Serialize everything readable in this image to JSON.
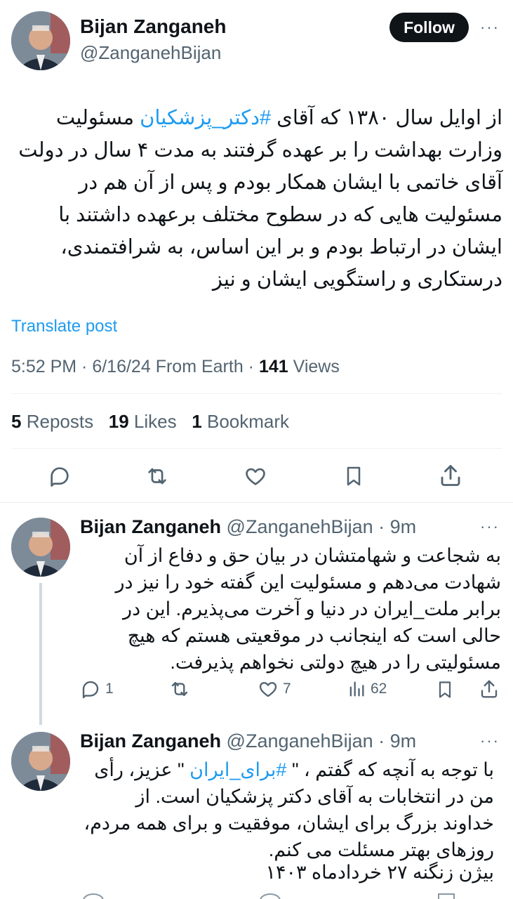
{
  "main_post": {
    "author_name": "Bijan Zanganeh",
    "author_handle": "@ZanganehBijan",
    "follow_label": "Follow",
    "text_before_tag": "از اوایل سال ۱۳۸۰ که آقای ",
    "hashtag": "#دکتر_پزشکیان",
    "text_after_tag": " مسئولیت وزارت بهداشت را بر عهده گرفتند به مدت ۴ سال در دولت آقای خاتمی با ایشان همکار بودم و پس از آن هم در مسئولیت هایی که در سطوح مختلف برعهده داشتند با ایشان در ارتباط بودم و بر این اساس، به شرافتمندی، درستکاری و راستگویی ایشان و نیز",
    "translate_label": "Translate post",
    "time": "5:52 PM",
    "date": "6/16/24",
    "source": "From Earth",
    "views_count": "141",
    "views_label": "Views",
    "reposts_count": "5",
    "reposts_label": "Reposts",
    "likes_count": "19",
    "likes_label": "Likes",
    "bookmarks_count": "1",
    "bookmarks_label": "Bookmark"
  },
  "replies": [
    {
      "author_name": "Bijan Zanganeh",
      "author_handle": "@ZanganehBijan",
      "time_ago": "9m",
      "text": "به شجاعت و شهامتشان در بیان حق و دفاع از آن شهادت می‌دهم و مسئولیت این گفته خود را نیز در برابر ملت_ایران در دنیا و آخرت می‌پذیرم. این در حالی است که اینجانب در موقعیتی هستم که هیچ مسئولیتی را در هیچ دولتی نخواهم پذیرفت.",
      "reply_count": "1",
      "repost_count": "",
      "like_count": "7",
      "views_count": "62"
    },
    {
      "author_name": "Bijan Zanganeh",
      "author_handle": "@ZanganehBijan",
      "time_ago": "9m",
      "text_before_tag": "با توجه به آنچه که گفتم ، \" ",
      "hashtag": "#برای_ایران",
      "text_after_tag": " \" عزیز، رأی من در انتخابات به آقای دکتر پزشکیان است. از خداوند بزرگ برای ایشان، موفقیت و برای همه مردم، روزهای بهتر مسئلت می کنم.",
      "signature": "بیژن زنگنه  ۲۷ خردادماه ۱۴۰۳"
    }
  ],
  "icons": [
    "reply-icon",
    "repost-icon",
    "like-icon",
    "bookmark-icon",
    "share-icon",
    "views-icon",
    "more-icon"
  ],
  "colors": {
    "accent": "#1d9bf0",
    "text": "#0f1419",
    "muted": "#536471",
    "follow_bg": "#0f1419"
  }
}
